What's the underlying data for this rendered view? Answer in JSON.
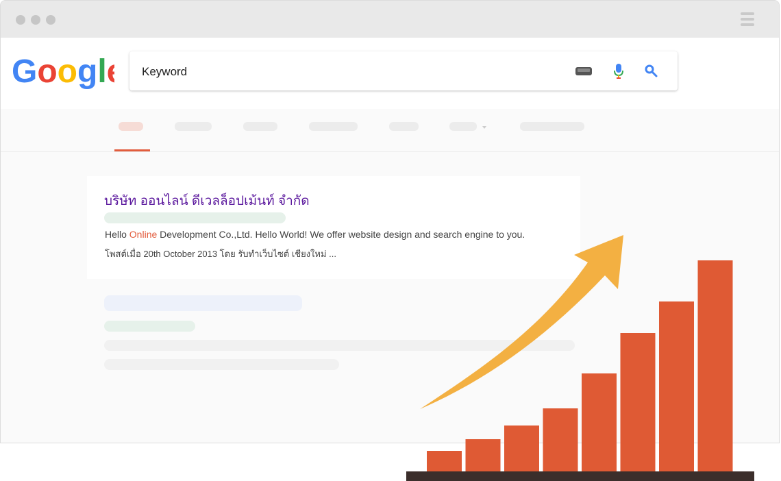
{
  "browser": {
    "title_dots": 3
  },
  "search": {
    "query": "Keyword"
  },
  "result": {
    "title": "บริษัท ออนไลน์ ดีเวลล็อปเม้นท์ จำกัด",
    "snippet_before": "Hello ",
    "snippet_highlight": "Online",
    "snippet_after": " Development Co.,Ltd. Hello World! We offer website design and search engine to you.",
    "meta": "โพสต์เมื่อ 20th October 2013 โดย รับทำเว็บไซต์ เชียงใหม่ ..."
  },
  "icons": [
    "menu-icon",
    "keyboard-icon",
    "microphone-icon",
    "search-icon",
    "growth-arrow-icon"
  ],
  "colors": {
    "accent": "#e25c3d",
    "result_title": "#5c1a9e",
    "bar": "#df5a34",
    "arrow": "#f3b042",
    "baseline": "#3b2e2b"
  },
  "chart_data": {
    "type": "bar",
    "categories": [
      "1",
      "2",
      "3",
      "4",
      "5",
      "6",
      "7",
      "8"
    ],
    "values": [
      30,
      47,
      67,
      92,
      143,
      202,
      248,
      308
    ],
    "title": "",
    "xlabel": "",
    "ylabel": "",
    "ylim": [
      0,
      308
    ]
  }
}
